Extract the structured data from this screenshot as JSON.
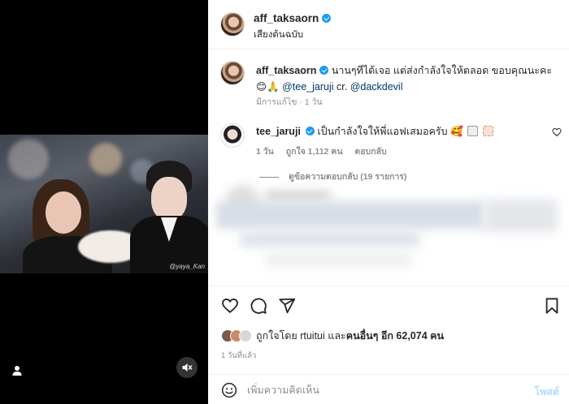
{
  "media": {
    "watermark": "@yaya_Kan"
  },
  "header": {
    "username": "aff_taksaorn",
    "audio": "เสียงต้นฉบับ"
  },
  "caption": {
    "username": "aff_taksaorn",
    "text": "นานๆทีได้เจอ แต่ส่งกำลังใจให้ตลอด ขอบคุณนะคะ",
    "emojis": "😊🙏",
    "mention1": "@tee_jaruji",
    "credit": "cr.",
    "mention2": "@dackdevil",
    "meta": "มีการแก้ไข · 1 วัน"
  },
  "comment": {
    "username": "tee_jaruji",
    "text": "เป็นกำลังใจให้พี่แอฟเสมอครับ",
    "emoji": "🥰",
    "time": "1 วัน",
    "likes": "ถูกใจ 1,112 คน",
    "reply": "ตอบกลับ",
    "view_replies": "ดูข้อความตอบกลับ (19 รายการ)"
  },
  "likes": {
    "prefix": "ถูกใจโดย",
    "user": "rtuitui",
    "middle": "และ",
    "others": "คนอื่นๆ อีก 62,074 คน"
  },
  "time_ago": "1 วันที่แล้ว",
  "add_comment": {
    "placeholder": "เพิ่มความคิดเห็น",
    "post_label": "โพสต์"
  },
  "colors": {
    "verified": "#1d9bf0",
    "link": "#00376b",
    "post_disabled": "#b2dffc",
    "meta_gray": "#8e8e8e"
  }
}
